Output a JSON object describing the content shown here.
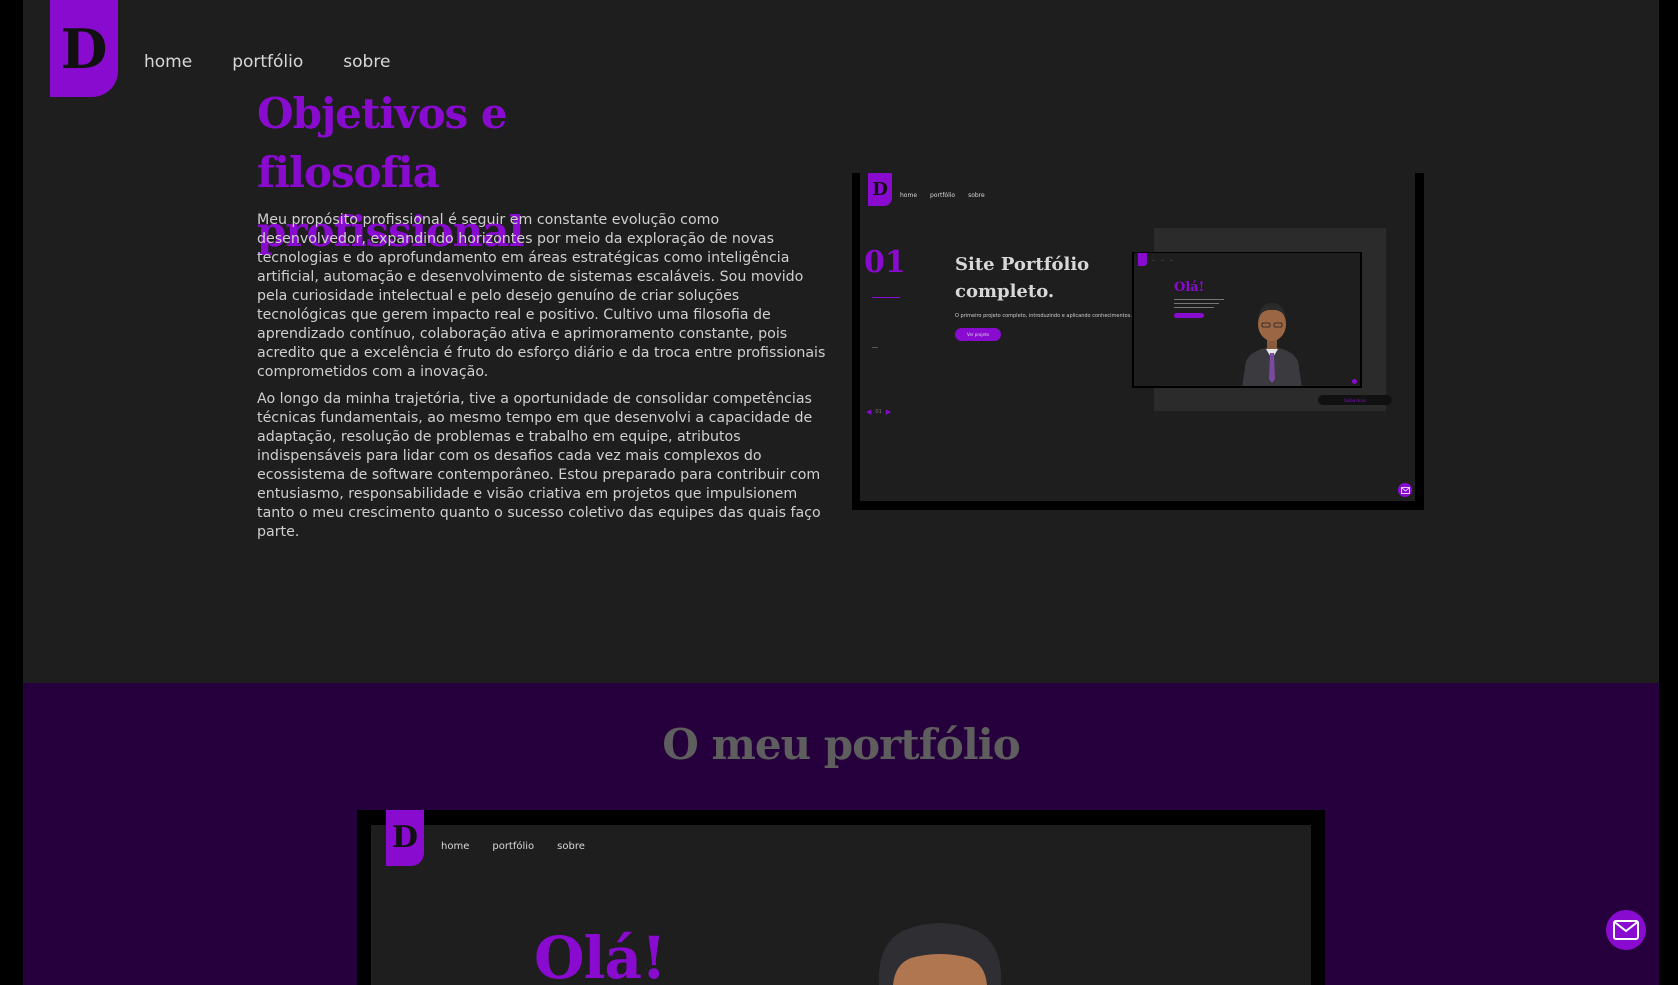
{
  "header": {
    "logo_letter": "D",
    "nav": [
      "home",
      "portfólio",
      "sobre"
    ]
  },
  "objectives": {
    "title": "Objetivos e filosofia profissional",
    "paragraph1": "Meu propósito profissional é seguir em constante evolução como desenvolvedor, expandindo horizontes por meio da exploração de novas tecnologias e do aprofundamento em áreas estratégicas como inteligência artificial, automação e desenvolvimento de sistemas escaláveis. Sou movido pela curiosidade intelectual e pelo desejo genuíno de criar soluções tecnológicas que gerem impacto real e positivo. Cultivo uma filosofia de aprendizado contínuo, colaboração ativa e aprimoramento constante, pois acredito que a excelência é fruto do esforço diário e da troca entre profissionais comprometidos com a inovação.",
    "paragraph2": "Ao longo da minha trajetória, tive a oportunidade de consolidar competências técnicas fundamentais, ao mesmo tempo em que desenvolvi a capacidade de adaptação, resolução de problemas e trabalho em equipe, atributos indispensáveis para lidar com os desafios cada vez mais complexos do ecossistema de software contemporâneo. Estou preparado para contribuir com entusiasmo, responsabilidade e visão criativa em projetos que impulsionem tanto o meu crescimento quanto o sucesso coletivo das equipes das quais faço parte."
  },
  "preview": {
    "logo_letter": "D",
    "nav": [
      "home",
      "portfólio",
      "sobre"
    ],
    "number": "01",
    "title": "Site Portfólio completo.",
    "description": "O primeiro projeto completo, introduzindo e aplicando conhecimentos.",
    "button": "Ver projeto",
    "pager": "01",
    "mini": {
      "hello": "Olá!",
      "see_more": "Saiba mais"
    }
  },
  "portfolio": {
    "title": "O meu portfólio",
    "logo_letter": "D",
    "nav": [
      "home",
      "portfólio",
      "sobre"
    ],
    "hello": "Olá!"
  },
  "colors": {
    "accent": "#8a0bd0",
    "background": "#1e1e1e",
    "purple_section": "#26003d"
  }
}
